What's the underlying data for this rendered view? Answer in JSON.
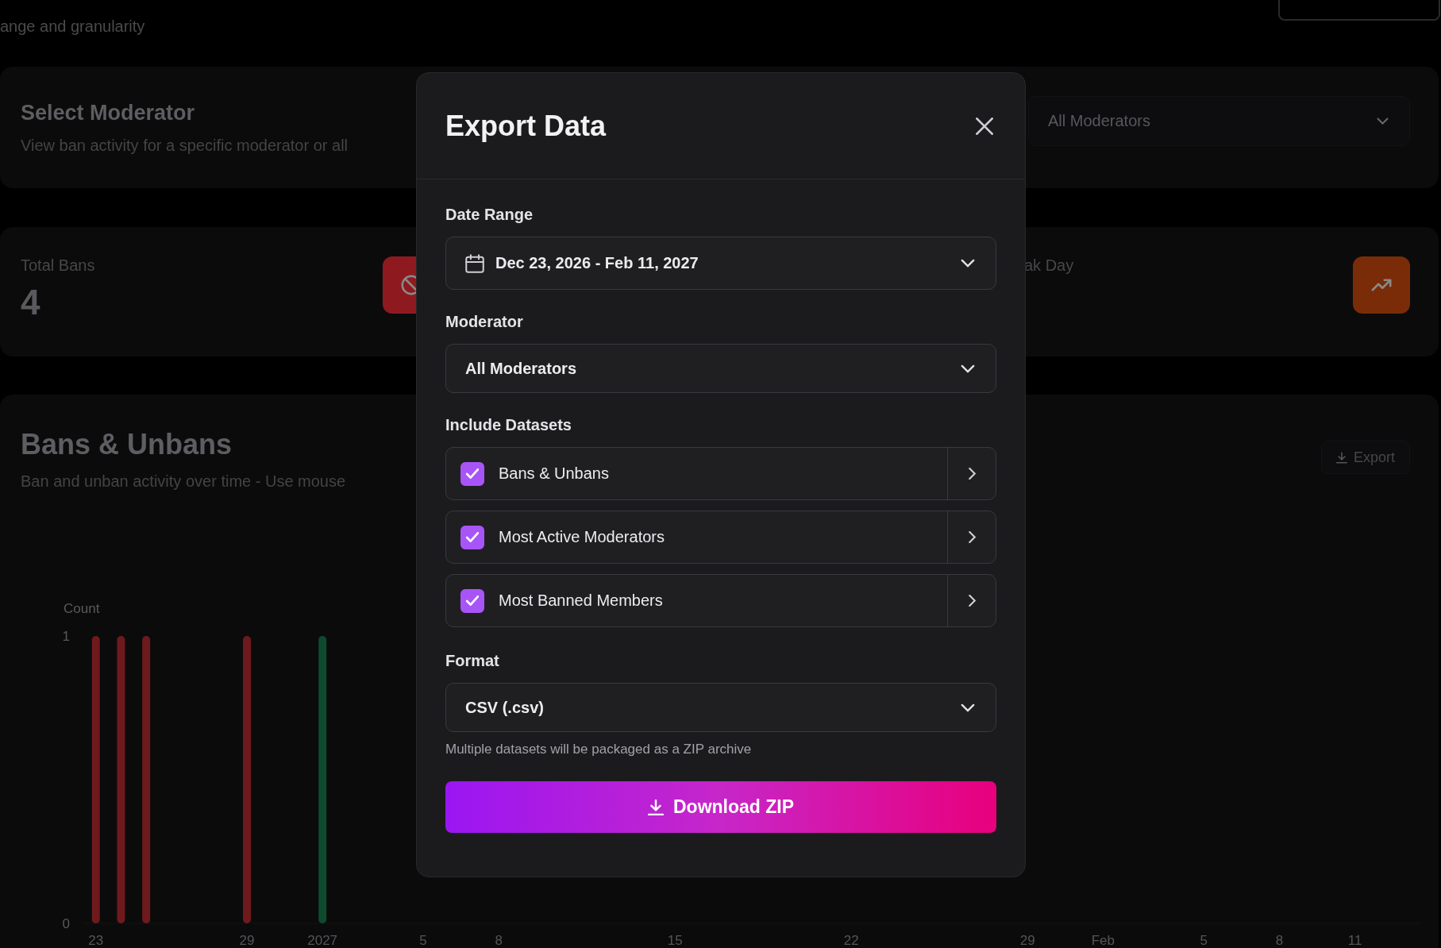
{
  "header": {
    "description_fragment": "ange and granularity"
  },
  "moderator_card": {
    "title": "Select Moderator",
    "description": "View ban activity for a specific moderator or all",
    "select": {
      "value": "All Moderators"
    }
  },
  "stats": [
    {
      "label": "Total Bans",
      "value": "4",
      "kind": "ban",
      "color": "#8e1a20"
    },
    {
      "label": "ak Day",
      "kind": "trend",
      "color": "#7a2c08"
    }
  ],
  "chart_card": {
    "title": "Bans & Unbans",
    "description": "Ban and unban activity over time - Use mouse",
    "export_button": "Export",
    "chart_data": {
      "type": "bar",
      "ylabel": "Count",
      "categories": [
        "23",
        null,
        null,
        null,
        null,
        null,
        "29",
        null,
        null,
        "2027",
        null,
        null,
        null,
        "5",
        null,
        null,
        "8",
        null,
        null,
        null,
        null,
        null,
        null,
        "15",
        null,
        null,
        null,
        null,
        null,
        null,
        "22",
        null,
        null,
        null,
        null,
        null,
        null,
        "29",
        null,
        null,
        "Feb",
        null,
        null,
        null,
        "5",
        null,
        null,
        "8",
        null,
        null,
        "11"
      ],
      "series": [
        {
          "color": "#6e1a1d",
          "values": [
            1,
            1,
            1,
            null,
            null,
            null,
            1,
            null,
            null,
            null,
            null,
            null,
            null,
            null,
            null,
            null,
            null,
            null,
            null,
            null,
            null,
            null,
            null,
            null,
            null,
            null,
            null,
            null,
            null,
            null,
            null,
            null,
            null,
            null,
            null,
            null,
            null,
            null,
            null,
            null,
            null,
            null,
            null,
            null,
            null,
            null,
            null,
            null,
            null,
            null,
            null
          ]
        },
        {
          "color": "#0e4a2d",
          "values": [
            null,
            null,
            null,
            null,
            null,
            null,
            null,
            null,
            null,
            1,
            null,
            null,
            null,
            null,
            null,
            null,
            null,
            null,
            null,
            null,
            null,
            null,
            null,
            null,
            null,
            null,
            null,
            null,
            null,
            null,
            null,
            null,
            null,
            null,
            null,
            null,
            null,
            null,
            null,
            null,
            null,
            null,
            null,
            null,
            null,
            null,
            null,
            null,
            null,
            null,
            null
          ]
        }
      ],
      "ylim": [
        0,
        1
      ],
      "yticks": [
        0,
        1
      ]
    }
  },
  "modal": {
    "title": "Export Data",
    "date_range": {
      "label": "Date Range",
      "value": "Dec 23, 2026 - Feb 11, 2027"
    },
    "moderator": {
      "label": "Moderator",
      "value": "All Moderators"
    },
    "datasets": {
      "label": "Include Datasets",
      "items": [
        {
          "label": "Bans & Unbans",
          "checked": true
        },
        {
          "label": "Most Active Moderators",
          "checked": true
        },
        {
          "label": "Most Banned Members",
          "checked": true
        }
      ]
    },
    "format": {
      "label": "Format",
      "value": "CSV (.csv)",
      "hint": "Multiple datasets will be packaged as a ZIP archive"
    },
    "download_button": "Download ZIP"
  }
}
